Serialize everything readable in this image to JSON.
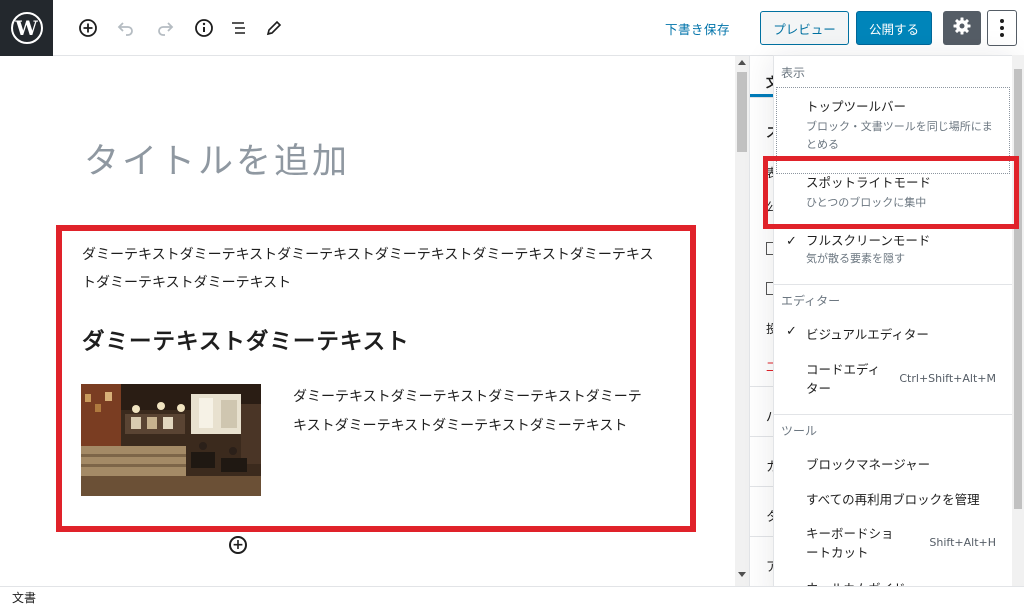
{
  "toolbar": {
    "logo_glyph": "W",
    "save_draft": "下書き保存",
    "preview": "プレビュー",
    "publish": "公開する",
    "icons": [
      "add-block-icon",
      "undo-icon",
      "redo-icon",
      "info-icon",
      "list-view-icon",
      "tools-pencil-icon",
      "gear-icon",
      "more-vertical-icon"
    ]
  },
  "editor": {
    "title_placeholder": "タイトルを追加",
    "paragraph1": "ダミーテキストダミーテキストダミーテキストダミーテキストダミーテキストダミーテキストダミーテキストダミーテキスト",
    "heading": "ダミーテキストダミーテキスト",
    "paragraph2": "ダミーテキストダミーテキストダミーテキストダミーテキストダミーテキストダミーテキストダミーテキスト",
    "image_alt": "cafe interior photo"
  },
  "sidebar": {
    "fragments": [
      "文",
      "ス",
      "表",
      "公",
      "投",
      "二",
      "パ",
      "カ",
      "タ",
      "ア"
    ]
  },
  "menu": {
    "view": {
      "label": "表示",
      "items": [
        {
          "label": "トップツールバー",
          "desc": "ブロック・文書ツールを同じ場所にまとめる",
          "checked": false
        },
        {
          "label": "スポットライトモード",
          "desc": "ひとつのブロックに集中",
          "checked": false
        },
        {
          "label": "フルスクリーンモード",
          "desc": "気が散る要素を隠す",
          "checked": true
        }
      ]
    },
    "editor": {
      "label": "エディター",
      "items": [
        {
          "label": "ビジュアルエディター",
          "checked": true,
          "shortcut": ""
        },
        {
          "label": "コードエディター",
          "checked": false,
          "shortcut": "Ctrl+Shift+Alt+M"
        }
      ]
    },
    "tools": {
      "label": "ツール",
      "items": [
        {
          "label": "ブロックマネージャー",
          "shortcut": ""
        },
        {
          "label": "すべての再利用ブロックを管理",
          "shortcut": ""
        },
        {
          "label": "キーボードショートカット",
          "shortcut": "Shift+Alt+H"
        },
        {
          "label": "ウェルカムガイド",
          "shortcut": ""
        }
      ]
    },
    "check_glyph": "✓"
  },
  "statusbar": {
    "label": "文書"
  },
  "colors": {
    "wp_dark": "#23282d",
    "link_blue": "#0073aa",
    "publish_blue": "#0085ba",
    "highlight_red": "#e0222a",
    "settings_gray": "#555d66"
  }
}
